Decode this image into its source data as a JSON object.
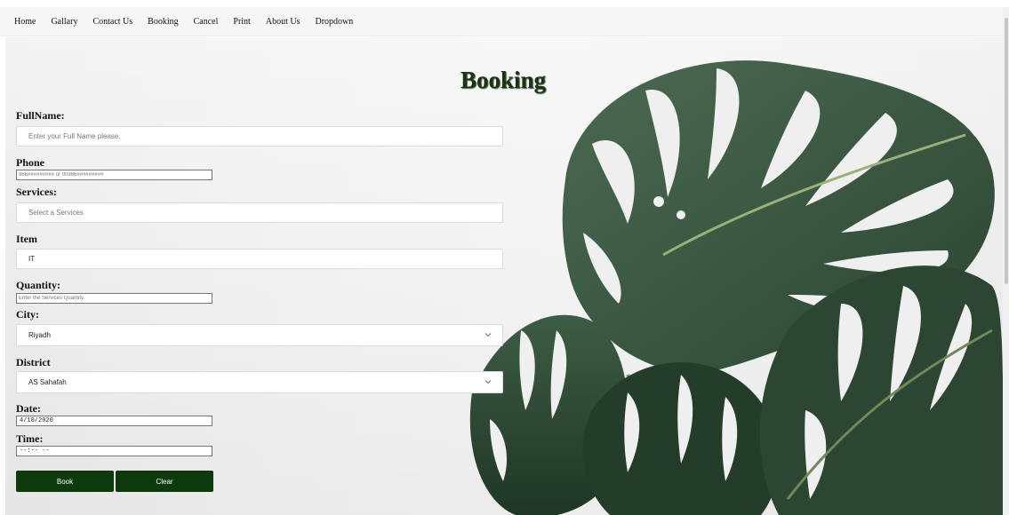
{
  "nav": {
    "items": [
      "Home",
      "Gallary",
      "Contact Us",
      "Booking",
      "Cancel",
      "Print",
      "About Us",
      "Dropdown"
    ]
  },
  "page": {
    "title": "Booking"
  },
  "form": {
    "fullname": {
      "label": "FullName:",
      "placeholder": "Enter your Full Name please."
    },
    "phone": {
      "label": "Phone Number:",
      "placeholder": "966######### or 00966#########"
    },
    "services": {
      "label": "Services:",
      "placeholder": "Select a Services"
    },
    "item_id": {
      "label": "Item ID:",
      "value": "IT"
    },
    "quantity": {
      "label": "Quantity:",
      "placeholder": "Enter the Services Quantity."
    },
    "city": {
      "label": "City:",
      "value": "Riyadh"
    },
    "district": {
      "label": "District",
      "value": "AS Sahafah"
    },
    "date": {
      "label": "Date:",
      "value": "4/10/2020"
    },
    "time": {
      "label": "Time:",
      "value": "--:-- --"
    }
  },
  "buttons": {
    "book": "Book",
    "clear": "Clear"
  },
  "colors": {
    "accent": "#0d3a0c",
    "title": "#17360f",
    "leaf_dark": "#2f4a36",
    "leaf_mid": "#3e5b45"
  },
  "icons": {
    "select_arrow": "chevron-down-icon"
  }
}
